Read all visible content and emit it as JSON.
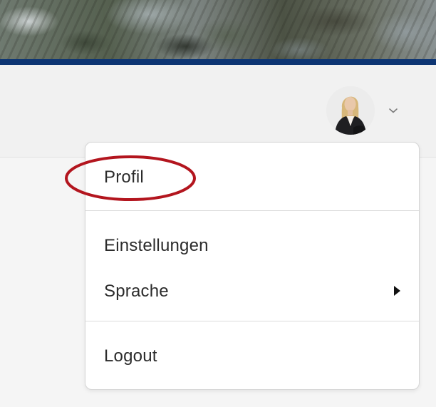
{
  "header": {
    "banner_icon": "foliage-photo",
    "stripe_color": "#0d3573"
  },
  "user_menu": {
    "avatar_icon": "user-avatar",
    "toggle_icon": "chevron-down-icon"
  },
  "dropdown": {
    "items": [
      {
        "label": "Profil"
      },
      {
        "label": "Einstellungen"
      },
      {
        "label": "Sprache",
        "submenu_icon": "caret-right-icon"
      },
      {
        "label": "Logout"
      }
    ]
  },
  "annotation": {
    "color": "#b3151e",
    "target": "Profil"
  }
}
